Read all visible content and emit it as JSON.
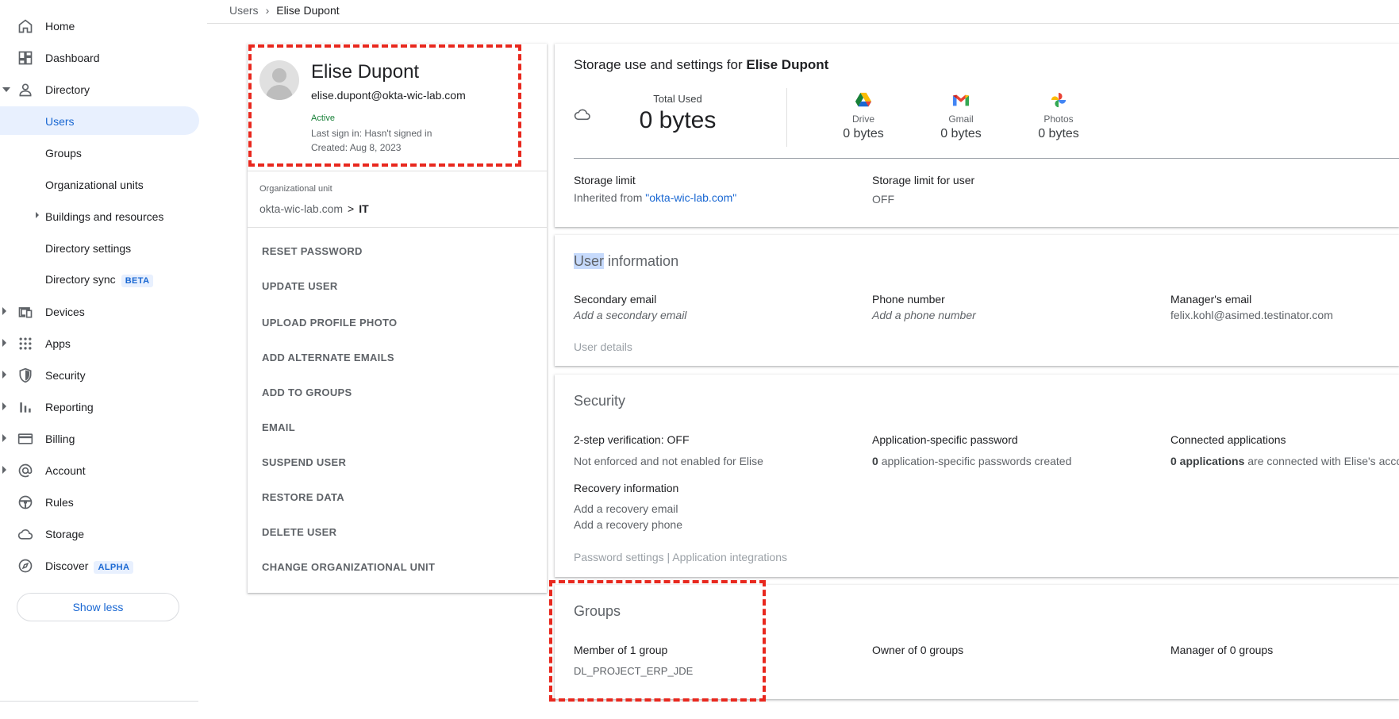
{
  "sidebar": {
    "items": [
      {
        "label": "Home",
        "icon": "home-icon"
      },
      {
        "label": "Dashboard",
        "icon": "dashboard-icon"
      },
      {
        "label": "Directory",
        "icon": "person-icon"
      },
      {
        "label": "Devices",
        "icon": "devices-icon"
      },
      {
        "label": "Apps",
        "icon": "apps-grid-icon"
      },
      {
        "label": "Security",
        "icon": "shield-icon"
      },
      {
        "label": "Reporting",
        "icon": "bar-chart-icon"
      },
      {
        "label": "Billing",
        "icon": "credit-card-icon"
      },
      {
        "label": "Account",
        "icon": "at-sign-icon"
      },
      {
        "label": "Rules",
        "icon": "steering-wheel-icon"
      },
      {
        "label": "Storage",
        "icon": "cloud-icon"
      },
      {
        "label": "Discover",
        "icon": "compass-icon"
      }
    ],
    "directory_sub": [
      {
        "label": "Users"
      },
      {
        "label": "Groups"
      },
      {
        "label": "Organizational units"
      },
      {
        "label": "Buildings and resources"
      },
      {
        "label": "Directory settings"
      },
      {
        "label": "Directory sync",
        "badge": "BETA"
      }
    ],
    "discover_badge": "ALPHA",
    "show_less": "Show less"
  },
  "breadcrumb": {
    "parent": "Users",
    "current": "Elise Dupont"
  },
  "profile": {
    "name": "Elise Dupont",
    "email": "elise.dupont@okta-wic-lab.com",
    "status": "Active",
    "last_sign_in": "Last sign in: Hasn't signed in",
    "created": "Created: Aug 8, 2023",
    "ou_label": "Organizational unit",
    "ou_root": "okta-wic-lab.com",
    "ou_sep": ">",
    "ou_leaf": "IT",
    "status_color": "#188038"
  },
  "actions": [
    "RESET PASSWORD",
    "UPDATE USER",
    "UPLOAD PROFILE PHOTO",
    "ADD ALTERNATE EMAILS",
    "ADD TO GROUPS",
    "EMAIL",
    "SUSPEND USER",
    "RESTORE DATA",
    "DELETE USER",
    "CHANGE ORGANIZATIONAL UNIT"
  ],
  "storage": {
    "title_prefix": "Storage use and settings for",
    "title_name": "Elise Dupont",
    "total_label": "Total Used",
    "total_value": "0 bytes",
    "services": [
      {
        "name": "Drive",
        "value": "0 bytes"
      },
      {
        "name": "Gmail",
        "value": "0 bytes"
      },
      {
        "name": "Photos",
        "value": "0 bytes"
      }
    ],
    "limit_label": "Storage limit",
    "limit_inherited_prefix": "Inherited from",
    "limit_inherited_domain": "\"okta-wic-lab.com\"",
    "user_limit_label": "Storage limit for user",
    "user_limit_value": "OFF"
  },
  "user_info": {
    "title_highlight": "User",
    "title_rest": "information",
    "secondary_email_label": "Secondary email",
    "secondary_email_placeholder": "Add a secondary email",
    "phone_label": "Phone number",
    "phone_placeholder": "Add a phone number",
    "manager_label": "Manager's email",
    "manager_value": "felix.kohl@asimed.testinator.com",
    "details_link": "User details"
  },
  "security": {
    "title": "Security",
    "two_step_label": "2-step verification:",
    "two_step_value": "OFF",
    "two_step_desc": "Not enforced and not enabled for Elise",
    "app_password_label": "Application-specific password",
    "app_password_count": "0",
    "app_password_desc": "application-specific passwords created",
    "connected_label": "Connected applications",
    "connected_count": "0 applications",
    "connected_desc": "are connected with Elise's accou",
    "recovery_label": "Recovery information",
    "recovery_email": "Add a recovery email",
    "recovery_phone": "Add a recovery phone",
    "footer_links": "Password settings | Application integrations"
  },
  "groups": {
    "title": "Groups",
    "member_label": "Member of 1 group",
    "member_group": "DL_PROJECT_ERP_JDE",
    "owner_label": "Owner of 0 groups",
    "manager_label": "Manager of 0 groups"
  },
  "colors": {
    "accent": "#1967d2",
    "selected_bg": "#e8f0fe",
    "highlight_dash": "#e8281e"
  }
}
